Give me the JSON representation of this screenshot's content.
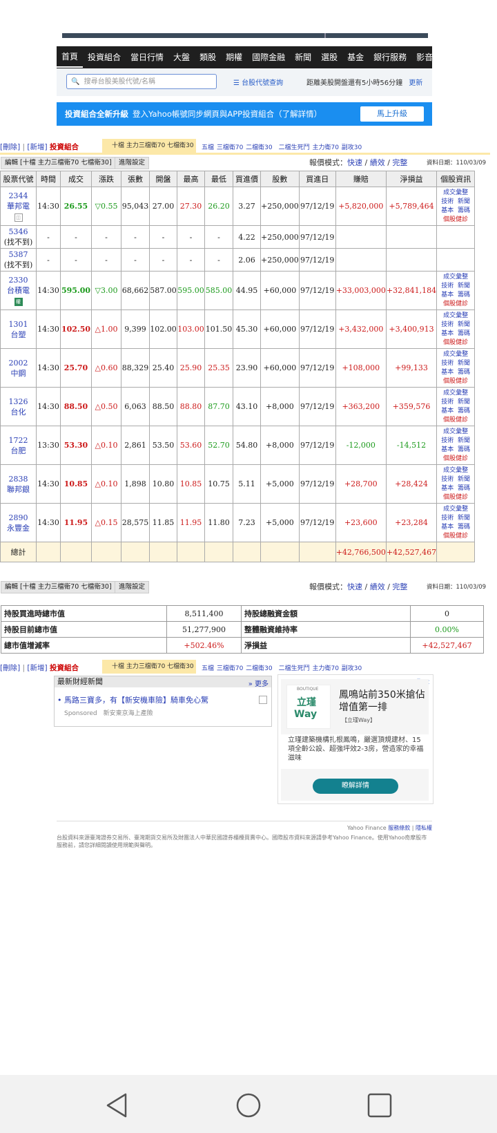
{
  "nav": {
    "items": [
      "首頁",
      "投資組合",
      "當日行情",
      "大盤",
      "類股",
      "期權",
      "國際金融",
      "新聞",
      "選股",
      "基金",
      "銀行服務",
      "影音"
    ],
    "active_index": 0
  },
  "search": {
    "placeholder": "搜尋台股美股代號/名稱"
  },
  "tools": {
    "code_query": "台股代號查詢",
    "countdown": "距離美股開盤還有5小時56分鐘",
    "refresh": "更新"
  },
  "promo": {
    "title": "投資組合全新升級",
    "text": "登入Yahoo帳號同步網頁與APP投資組合（了解詳情）",
    "button": "馬上升級"
  },
  "portfolio": {
    "delete": "[刪除]",
    "add": "[新增]",
    "name": "投資組合",
    "active_tab": "十檔 主力三檔衛70 七檔衛30",
    "tabs": "五檔 三檔衛70 二檔衛30　二檔生死鬥 主力衛70 副攻30",
    "edit_button": "編輯 [十檔 主力三檔衛70 七檔衛30]",
    "settings_button": "進階設定",
    "quote_mode_label": "報價模式：",
    "quote_modes": [
      "快速",
      "績效",
      "完整"
    ],
    "data_date": "資料日期：110/03/09"
  },
  "table": {
    "headers": [
      "股票代號",
      "時間",
      "成交",
      "漲跌",
      "張數",
      "開盤",
      "最高",
      "最低",
      "買進價",
      "股數",
      "買進日",
      "賺賠",
      "淨損益",
      "個股資訊"
    ],
    "rows": [
      {
        "code": "2344",
        "name": "華邦電",
        "badge": "",
        "time": "14:30",
        "price": "26.55",
        "price_c": "green-b",
        "chg": "▽0.55",
        "chg_c": "green",
        "vol": "95,043",
        "open": "27.00",
        "high": "27.30",
        "high_c": "red",
        "low": "26.20",
        "low_c": "green",
        "buy": "3.27",
        "shares": "+250,000",
        "date": "97/12/19",
        "pl": "+5,820,000",
        "pl_c": "red",
        "net": "+5,789,464",
        "net_c": "red",
        "links": true
      },
      {
        "code": "5346",
        "name": "(找不到)",
        "badge": "",
        "time": "-",
        "price": "-",
        "price_c": "",
        "chg": "-",
        "chg_c": "",
        "vol": "-",
        "open": "-",
        "high": "-",
        "high_c": "",
        "low": "-",
        "low_c": "",
        "buy": "4.22",
        "shares": "+250,000",
        "date": "97/12/19",
        "pl": "",
        "pl_c": "",
        "net": "",
        "net_c": "",
        "links": false
      },
      {
        "code": "5387",
        "name": "(找不到)",
        "badge": "",
        "time": "-",
        "price": "-",
        "price_c": "",
        "chg": "-",
        "chg_c": "",
        "vol": "-",
        "open": "-",
        "high": "-",
        "high_c": "",
        "low": "-",
        "low_c": "",
        "buy": "2.06",
        "shares": "+250,000",
        "date": "97/12/19",
        "pl": "",
        "pl_c": "",
        "net": "",
        "net_c": "",
        "links": false
      },
      {
        "code": "2330",
        "name": "台積電",
        "badge": "權",
        "time": "14:30",
        "price": "595.00",
        "price_c": "green-b",
        "chg": "▽3.00",
        "chg_c": "green",
        "vol": "68,662",
        "open": "587.00",
        "high": "595.00",
        "high_c": "green",
        "low": "585.00",
        "low_c": "green",
        "buy": "44.95",
        "shares": "+60,000",
        "date": "97/12/19",
        "pl": "+33,003,000",
        "pl_c": "red",
        "net": "+32,841,184",
        "net_c": "red",
        "links": true
      },
      {
        "code": "1301",
        "name": "台塑",
        "badge": "",
        "time": "14:30",
        "price": "102.50",
        "price_c": "red-b",
        "chg": "△1.00",
        "chg_c": "red",
        "vol": "9,399",
        "open": "102.00",
        "high": "103.00",
        "high_c": "red",
        "low": "101.50",
        "low_c": "",
        "buy": "45.30",
        "shares": "+60,000",
        "date": "97/12/19",
        "pl": "+3,432,000",
        "pl_c": "red",
        "net": "+3,400,913",
        "net_c": "red",
        "links": true
      },
      {
        "code": "2002",
        "name": "中鋼",
        "badge": "",
        "time": "14:30",
        "price": "25.70",
        "price_c": "red-b",
        "chg": "△0.60",
        "chg_c": "red",
        "vol": "88,329",
        "open": "25.40",
        "high": "25.90",
        "high_c": "red",
        "low": "25.35",
        "low_c": "red",
        "buy": "23.90",
        "shares": "+60,000",
        "date": "97/12/19",
        "pl": "+108,000",
        "pl_c": "red",
        "net": "+99,133",
        "net_c": "red",
        "links": true
      },
      {
        "code": "1326",
        "name": "台化",
        "badge": "",
        "time": "14:30",
        "price": "88.50",
        "price_c": "red-b",
        "chg": "△0.50",
        "chg_c": "red",
        "vol": "6,063",
        "open": "88.50",
        "high": "88.80",
        "high_c": "red",
        "low": "87.70",
        "low_c": "green",
        "buy": "43.10",
        "shares": "+8,000",
        "date": "97/12/19",
        "pl": "+363,200",
        "pl_c": "red",
        "net": "+359,576",
        "net_c": "red",
        "links": true
      },
      {
        "code": "1722",
        "name": "台肥",
        "badge": "",
        "time": "13:30",
        "price": "53.30",
        "price_c": "red-b",
        "chg": "△0.10",
        "chg_c": "red",
        "vol": "2,861",
        "open": "53.50",
        "high": "53.60",
        "high_c": "red",
        "low": "52.70",
        "low_c": "green",
        "buy": "54.80",
        "shares": "+8,000",
        "date": "97/12/19",
        "pl": "-12,000",
        "pl_c": "green",
        "net": "-14,512",
        "net_c": "green",
        "links": true
      },
      {
        "code": "2838",
        "name": "聯邦銀",
        "badge": "",
        "time": "14:30",
        "price": "10.85",
        "price_c": "red-b",
        "chg": "△0.10",
        "chg_c": "red",
        "vol": "1,898",
        "open": "10.80",
        "high": "10.85",
        "high_c": "red",
        "low": "10.75",
        "low_c": "",
        "buy": "5.11",
        "shares": "+5,000",
        "date": "97/12/19",
        "pl": "+28,700",
        "pl_c": "red",
        "net": "+28,424",
        "net_c": "red",
        "links": true
      },
      {
        "code": "2890",
        "name": "永豐金",
        "badge": "",
        "time": "14:30",
        "price": "11.95",
        "price_c": "red-b",
        "chg": "△0.15",
        "chg_c": "red",
        "vol": "28,575",
        "open": "11.85",
        "high": "11.95",
        "high_c": "red",
        "low": "11.80",
        "low_c": "",
        "buy": "7.23",
        "shares": "+5,000",
        "date": "97/12/19",
        "pl": "+23,600",
        "pl_c": "red",
        "net": "+23,284",
        "net_c": "red",
        "links": true
      }
    ],
    "info_links": [
      "成交彙整",
      "技術",
      "新聞",
      "基本",
      "籌碼",
      "個股健診"
    ],
    "total_label": "總計",
    "total_pl": "+42,766,500",
    "total_net": "+42,527,467"
  },
  "summary": {
    "holding_buy_value_label": "持股買進時總市值",
    "holding_buy_value": "8,511,400",
    "margin_total_label": "持股總融資金額",
    "margin_total": "0",
    "current_value_label": "持股目前總市值",
    "current_value": "51,277,900",
    "margin_ratio_label": "整體融資維持率",
    "margin_ratio": "0.00%",
    "value_change_label": "總市值增減率",
    "value_change": "+502.46%",
    "net_label": "淨損益",
    "net": "+42,527,467"
  },
  "news": {
    "title": "最新財經新聞",
    "more": "» 更多",
    "item": "馬路三寶多，有【新安機車險】騎車免心驚",
    "sponsor": "Sponsored　新安東京海上產險"
  },
  "ad": {
    "logo_top": "立瑾",
    "logo_bottom": "Way",
    "logo_small": "BOUTIQUE",
    "headline": "鳳鳴站前350米搶佔增值第一排",
    "brand": "【立瑾Way】",
    "desc": "立瑾建築機構扎根鳳鳴，嚴選頂規建材、15項全齡公設、超強坪效2-3房，營造家的幸福滋味",
    "cta": "瞭解詳情"
  },
  "footer": {
    "brand": "Yahoo Finance",
    "terms": "服務條款",
    "privacy": "隱私權",
    "line1": "台股資料來源臺灣證券交易所、臺灣期貨交易所及財團法人中華民國證券櫃檯買賣中心。國際股市資料來源請參考Yahoo Finance。使用Yahoo奇摩股市服務前，請您詳細閱讀使用規範與聲明。"
  },
  "colors": {
    "nav_bg": "#1f1f1f",
    "promo_bg": "#1a8ef0",
    "link": "#2a3fb5",
    "up": "#cc1a1a",
    "down": "#1b9a1b",
    "tab_active": "#fce8a8"
  }
}
